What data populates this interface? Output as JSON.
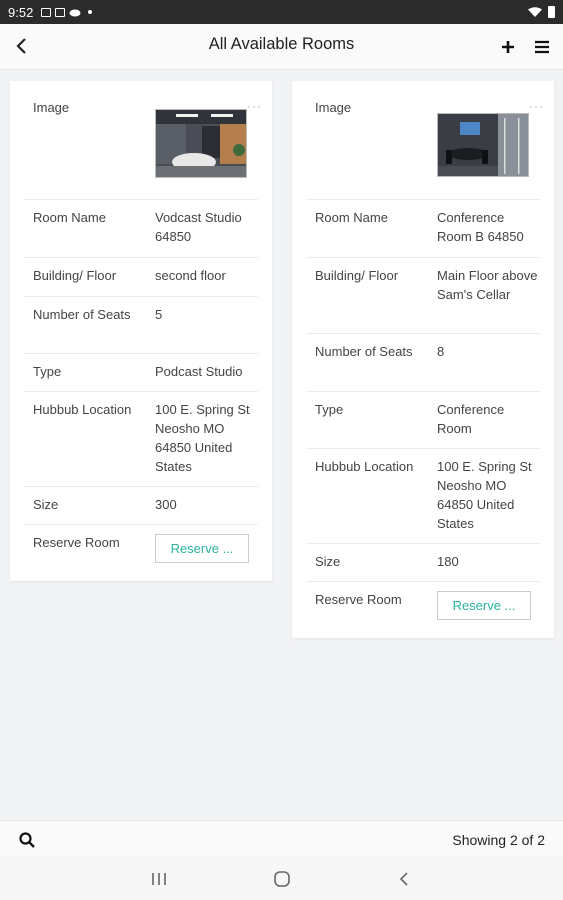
{
  "status_bar": {
    "time": "9:52"
  },
  "header": {
    "title": "All Available Rooms"
  },
  "labels": {
    "image": "Image",
    "room_name": "Room Name",
    "building_floor": "Building/ Floor",
    "number_of_seats": "Number of Seats",
    "type": "Type",
    "hubbub_location": "Hubbub Location",
    "size": "Size",
    "reserve_room": "Reserve Room",
    "more": "···"
  },
  "rooms": [
    {
      "room_name": "Vodcast Studio 64850",
      "building_floor": "second floor",
      "number_of_seats": "5",
      "type": "Podcast Studio",
      "hubbub_location": "100 E. Spring St Neosho MO 64850 United States",
      "size": "300",
      "reserve_label": "Reserve ..."
    },
    {
      "room_name": "Conference Room B 64850",
      "building_floor": "Main Floor above Sam's Cellar",
      "number_of_seats": "8",
      "type": "Conference Room",
      "hubbub_location": "100 E. Spring St Neosho MO 64850 United States",
      "size": "180",
      "reserve_label": "Reserve ..."
    }
  ],
  "footer": {
    "showing": "Showing 2 of 2"
  },
  "colors": {
    "accent": "#2bb3a0",
    "status_bar": "#2b2b2b"
  }
}
